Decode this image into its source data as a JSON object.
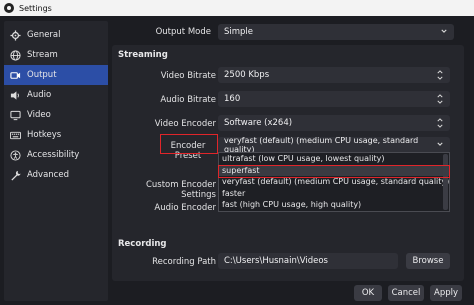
{
  "window": {
    "title": "Settings"
  },
  "sidebar": {
    "items": [
      {
        "label": "General",
        "icon": "gear-icon"
      },
      {
        "label": "Stream",
        "icon": "globe-icon"
      },
      {
        "label": "Output",
        "icon": "output-icon",
        "active": true
      },
      {
        "label": "Audio",
        "icon": "speaker-icon"
      },
      {
        "label": "Video",
        "icon": "monitor-icon"
      },
      {
        "label": "Hotkeys",
        "icon": "keyboard-icon"
      },
      {
        "label": "Accessibility",
        "icon": "accessibility-icon"
      },
      {
        "label": "Advanced",
        "icon": "wrench-icon"
      }
    ]
  },
  "output_mode": {
    "label": "Output Mode",
    "value": "Simple"
  },
  "streaming": {
    "title": "Streaming",
    "video_bitrate": {
      "label": "Video Bitrate",
      "value": "2500 Kbps"
    },
    "audio_bitrate": {
      "label": "Audio Bitrate",
      "value": "160"
    },
    "video_encoder": {
      "label": "Video Encoder",
      "value": "Software (x264)"
    },
    "encoder_preset": {
      "label": "Encoder Preset",
      "value": "veryfast (default) (medium CPU usage, standard quality)"
    },
    "custom_settings": {
      "label": "Custom Encoder Settings"
    },
    "audio_encoder": {
      "label": "Audio Encoder"
    }
  },
  "preset_dropdown": {
    "options": [
      "ultrafast (low CPU usage, lowest quality)",
      "superfast",
      "veryfast (default) (medium CPU usage, standard quality)",
      "faster",
      "fast (high CPU usage, high quality)"
    ],
    "selected_index": 1
  },
  "recording": {
    "title": "Recording",
    "path": {
      "label": "Recording Path",
      "value": "C:\\Users\\Husnain\\Videos"
    },
    "browse_label": "Browse"
  },
  "footer": {
    "ok": "OK",
    "cancel": "Cancel",
    "apply": "Apply"
  },
  "colors": {
    "accent": "#2c4ea6",
    "highlight": "#e0252a",
    "background": "#1c1d22",
    "panel": "#25262c"
  }
}
